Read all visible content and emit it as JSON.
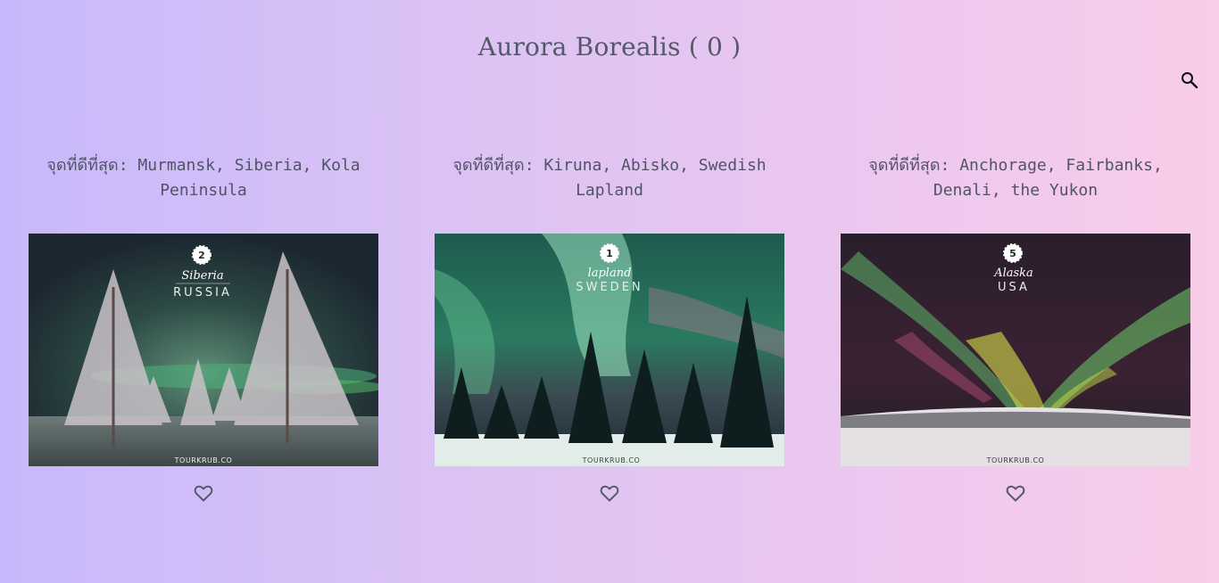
{
  "header": {
    "title": "Aurora Borealis ( 0 )"
  },
  "toolbar": {
    "search_icon": "search-icon"
  },
  "cards": [
    {
      "caption": "จุดที่ดีที่สุด: Murmansk, Siberia, Kola Peninsula",
      "image": {
        "number": "2",
        "place": "Siberia",
        "country": "RUSSIA",
        "watermark": "TOURKRUB.CO"
      },
      "like_icon": "heart-outline-icon"
    },
    {
      "caption": "จุดที่ดีที่สุด: Kiruna, Abisko, Swedish Lapland",
      "image": {
        "number": "1",
        "place": "lapland",
        "country": "SWEDEN",
        "watermark": "TOURKRUB.CO"
      },
      "like_icon": "heart-outline-icon"
    },
    {
      "caption": "จุดที่ดีที่สุด: Anchorage, Fairbanks, Denali, the Yukon",
      "image": {
        "number": "5",
        "place": "Alaska",
        "country": "USA",
        "watermark": "TOURKRUB.CO"
      },
      "like_icon": "heart-outline-icon"
    }
  ]
}
